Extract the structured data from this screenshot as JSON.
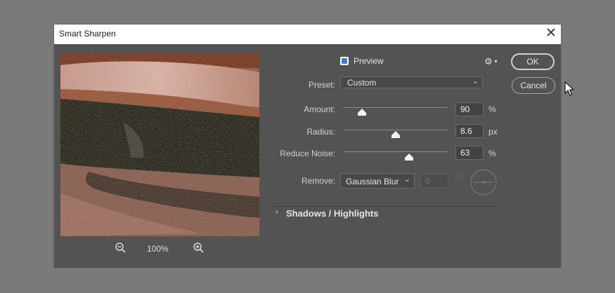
{
  "dialog": {
    "title": "Smart Sharpen",
    "close_glyph": "✕"
  },
  "preview_pane": {
    "zoom_level": "100%",
    "zoom_out_icon": "zoom-out-magnifier-icon",
    "zoom_in_icon": "zoom-in-magnifier-icon"
  },
  "options": {
    "preview_label": "Preview",
    "preview_checked": true,
    "gear_icon": "gear-icon"
  },
  "preset": {
    "label": "Preset:",
    "value": "Custom"
  },
  "sliders": {
    "amount": {
      "label": "Amount:",
      "value": "90",
      "unit": "%",
      "level": 0.18
    },
    "radius": {
      "label": "Radius:",
      "value": "8.6",
      "unit": "px",
      "level": 0.5
    },
    "reduce_noise": {
      "label": "Reduce Noise:",
      "value": "63",
      "unit": "%",
      "level": 0.63
    }
  },
  "remove": {
    "label": "Remove:",
    "value": "Gaussian Blur",
    "angle_value": "0",
    "angle_unit": "°"
  },
  "shadows_highlights": {
    "label": "Shadows / Highlights",
    "expanded": false
  },
  "buttons": {
    "ok": "OK",
    "cancel": "Cancel"
  },
  "colors": {
    "dialog_bg": "#535353",
    "backdrop": "#7a7a7a",
    "checkbox_accent": "#3b7fd6"
  }
}
